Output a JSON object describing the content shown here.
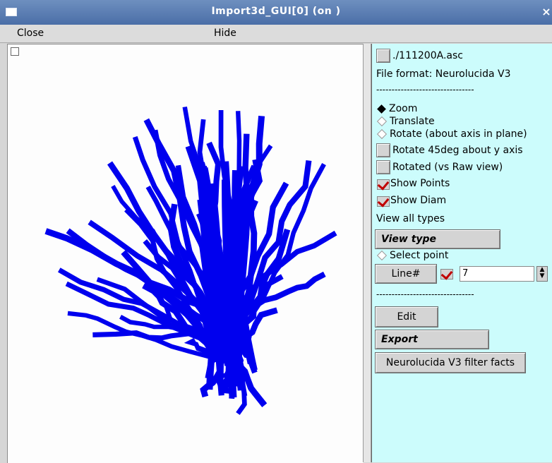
{
  "window": {
    "title": "Import3d_GUI[0] (on )",
    "close_glyph": "×"
  },
  "menu": {
    "close": "Close",
    "hide": "Hide"
  },
  "panel": {
    "file_label": "./111200A.asc",
    "file_format": "File format: Neurolucida V3",
    "separator1": "--------------------------------",
    "zoom": "Zoom",
    "translate": "Translate",
    "rotate_plane": "Rotate (about axis in plane)",
    "rotate45": "Rotate 45deg about y axis",
    "rotated_raw": "Rotated (vs Raw view)",
    "show_points": "Show Points",
    "show_diam": "Show Diam",
    "view_all_types": "View all types",
    "view_type": "View type",
    "select_point": "Select point",
    "line_button": "Line#",
    "line_value": "7",
    "separator2": "--------------------------------",
    "edit": "Edit",
    "export": "Export",
    "filter_facts": "Neurolucida V3 filter facts"
  },
  "colors": {
    "neuron": "#0000ee",
    "panel_bg": "#ccfcfc",
    "titlebar": "#4a6ea7"
  }
}
